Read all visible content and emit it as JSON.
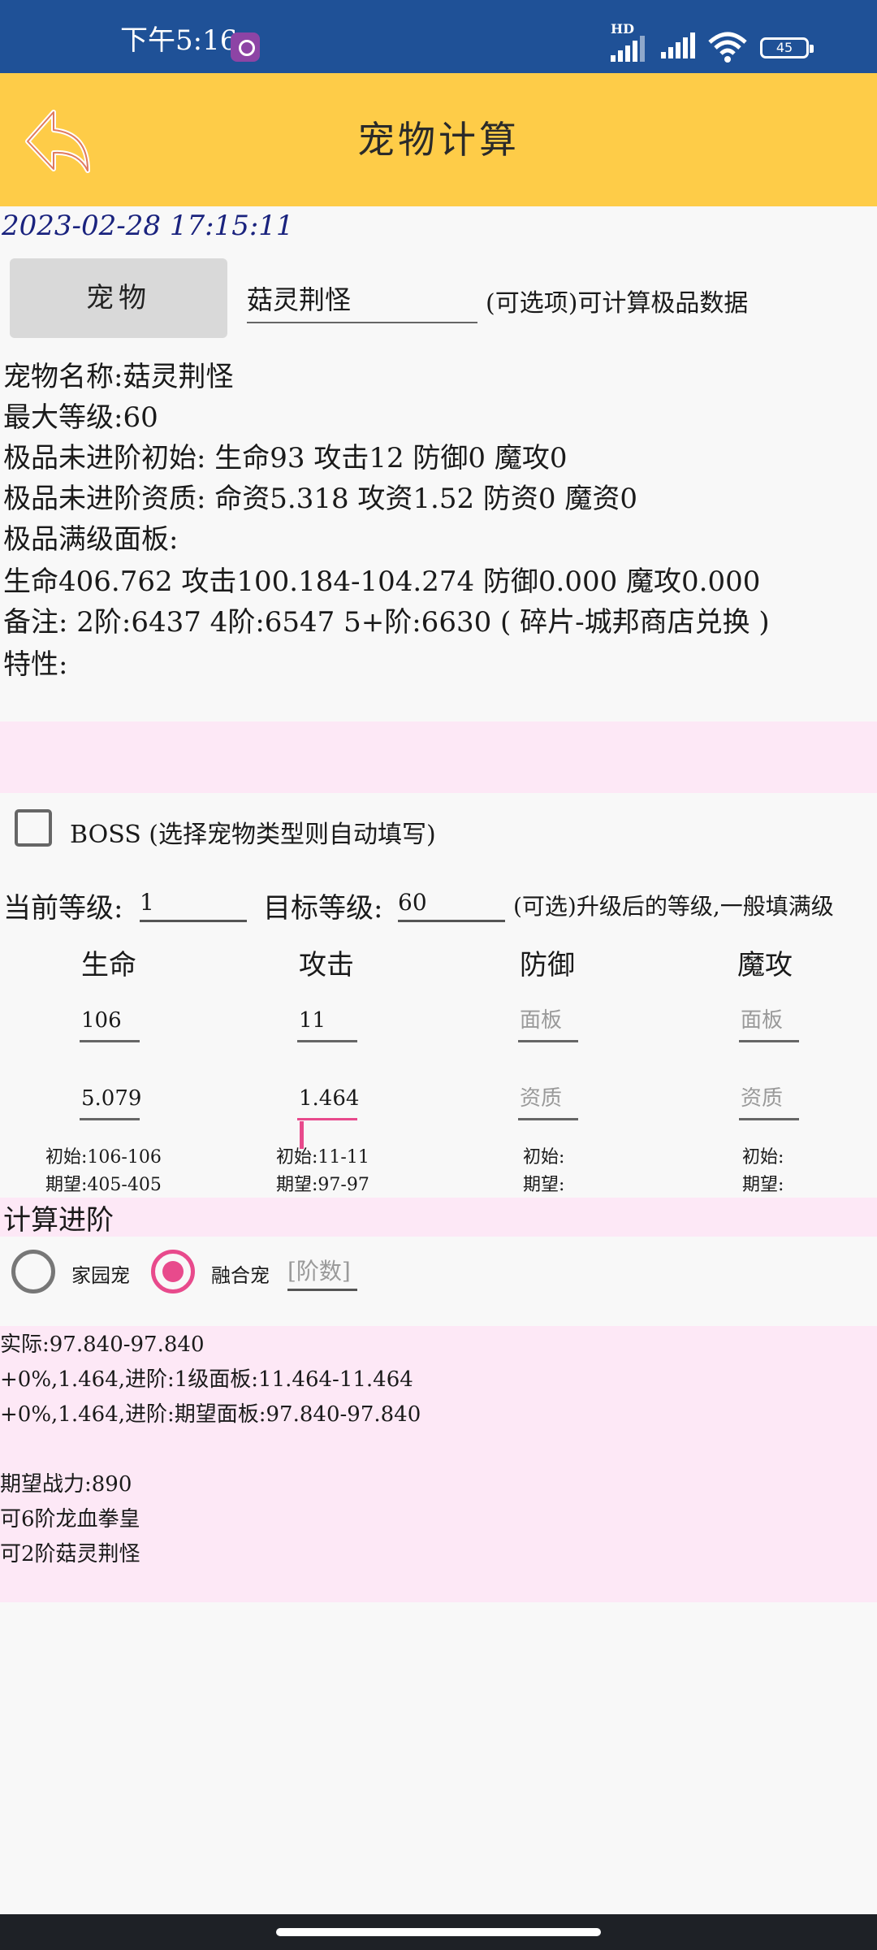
{
  "status_bar": {
    "time": "下午5:16",
    "network_label": "HD",
    "battery": "45"
  },
  "header": {
    "title": "宠物计算"
  },
  "timestamp": "2023-02-28 17:15:11",
  "pet_select": {
    "button_label": "宠物",
    "input_value": "菇灵荆怪",
    "hint": "(可选项)可计算极品数据"
  },
  "pet_info": {
    "lines": [
      "宠物名称:菇灵荆怪",
      "最大等级:60",
      "极品未进阶初始: 生命93 攻击12 防御0 魔攻0",
      "极品未进阶资质: 命资5.318 攻资1.52 防资0 魔资0",
      "极品满级面板:",
      " 生命406.762 攻击100.184-104.274 防御0.000 魔攻0.000",
      "备注: 2阶:6437 4阶:6547 5+阶:6630 ( 碎片-城邦商店兑换 )",
      "特性:"
    ]
  },
  "boss": {
    "label": "BOSS (选择宠物类型则自动填写)",
    "checked": false
  },
  "levels": {
    "current_label": "当前等级:",
    "current_value": "1",
    "target_label": "目标等级:",
    "target_value": "60",
    "hint": "(可选)升级后的等级,一般填满级"
  },
  "stats": {
    "columns": [
      {
        "header": "生命",
        "panel": "106",
        "aptitude": "5.079",
        "initial": "初始:106-106",
        "expected": "期望:405-405"
      },
      {
        "header": "攻击",
        "panel": "11",
        "aptitude": "1.464",
        "initial": "初始:11-11",
        "expected": "期望:97-97"
      },
      {
        "header": "防御",
        "panel_placeholder": "面板",
        "aptitude_placeholder": "资质",
        "initial": "初始:",
        "expected": "期望:"
      },
      {
        "header": "魔攻",
        "panel_placeholder": "面板",
        "aptitude_placeholder": "资质",
        "initial": "初始:",
        "expected": "期望:"
      }
    ]
  },
  "advance": {
    "section_title": "计算进阶",
    "options": [
      "家园宠",
      "融合宠"
    ],
    "selected": "融合宠",
    "tier_placeholder": "[阶数]"
  },
  "results": {
    "lines": [
      "实际:97.840-97.840",
      "+0%,1.464,进阶:1级面板:11.464-11.464",
      "+0%,1.464,进阶:期望面板:97.840-97.840",
      "",
      "期望战力:890",
      "可6阶龙血拳皇",
      "可2阶菇灵荆怪"
    ]
  }
}
